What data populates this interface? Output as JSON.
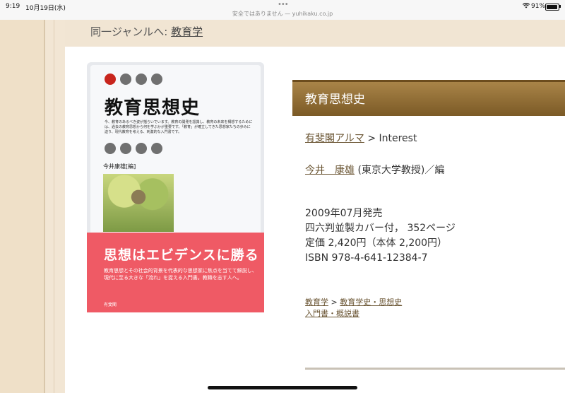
{
  "status_bar": {
    "time": "9:19",
    "date": "10月19日(水)",
    "url_text": "安全ではありません — yuhikaku.co.jp",
    "battery": "91%",
    "battery_level": 0.91
  },
  "breadcrumb": {
    "label": "同一ジャンルへ: ",
    "link": "教育学"
  },
  "cover": {
    "title": "教育思想史",
    "blurb": "今、教育のあるべき姿が揺らいでいます。教育の開発を認識し、教育の未来を構想するためには、過去の教育思想から何を学ぶかが重要です。「教育」が確立してきた思想家たちの歩みに迫り、現代教育を考える、刺激的な入門書です。",
    "author": "今井康雄[編]",
    "headline": "思想はエビデンスに勝る",
    "band_text": "教育思想とその社会的背景を代表的な思想家に焦点を当てて解説し、現代に至る大きな「流れ」を捉える入門書。教職を志す人へ。",
    "publisher": "有斐閣"
  },
  "book": {
    "title": "教育思想史",
    "series_link": "有斐閣アルマ",
    "series_suffix": " > Interest",
    "author_link": "今井　康雄",
    "author_suffix": " (東京大学教授)／編",
    "release": "2009年07月発売",
    "format": "四六判並製カバー付，  352ページ",
    "price": "定価 2,420円（本体 2,200円）",
    "isbn": "ISBN 978-4-641-12384-7"
  },
  "categories": {
    "cat1": "教育学",
    "sep": " > ",
    "cat2": "教育学史・思想史",
    "cat3": "入門書・概説書"
  },
  "colors": {
    "page_bg": "#f2e6d4",
    "title_bar": "#8c6a33",
    "cover_band": "#ef5a65",
    "link": "#6b5634"
  }
}
